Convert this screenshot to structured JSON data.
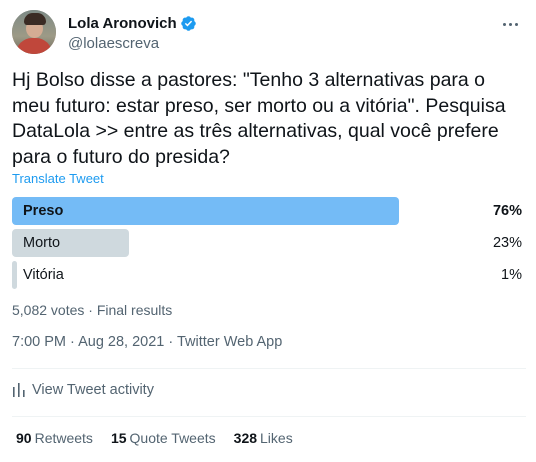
{
  "user": {
    "display_name": "Lola Aronovich",
    "handle": "@lolaescreva",
    "verified": true
  },
  "tweet": {
    "text": "Hj Bolso disse a pastores: \"Tenho 3 alternativas para o meu futuro: estar preso, ser morto ou a vitória\". Pesquisa DataLola >> entre as três alternativas, qual você prefere para o futuro do presida?",
    "translate_label": "Translate Tweet"
  },
  "poll": {
    "options": [
      {
        "label": "Preso",
        "percent_text": "76%",
        "percent": 76,
        "winner": true
      },
      {
        "label": "Morto",
        "percent_text": "23%",
        "percent": 23,
        "winner": false
      },
      {
        "label": "Vitória",
        "percent_text": "1%",
        "percent": 1,
        "winner": false
      }
    ],
    "meta": "5,082 votes · Final results"
  },
  "timestamp": "7:00 PM · Aug 28, 2021 · Twitter Web App",
  "activity_label": "View Tweet activity",
  "stats": {
    "retweets_count": "90",
    "retweets_label": "Retweets",
    "quotes_count": "15",
    "quotes_label": "Quote Tweets",
    "likes_count": "328",
    "likes_label": "Likes"
  },
  "colors": {
    "accent": "#1d9bf0",
    "poll_winner": "#74bbf6",
    "poll_other": "#cfd9de",
    "secondary_text": "#536471"
  },
  "icons": {
    "verified": "verified-badge-icon",
    "more": "more-options-icon",
    "activity": "bar-chart-icon"
  }
}
